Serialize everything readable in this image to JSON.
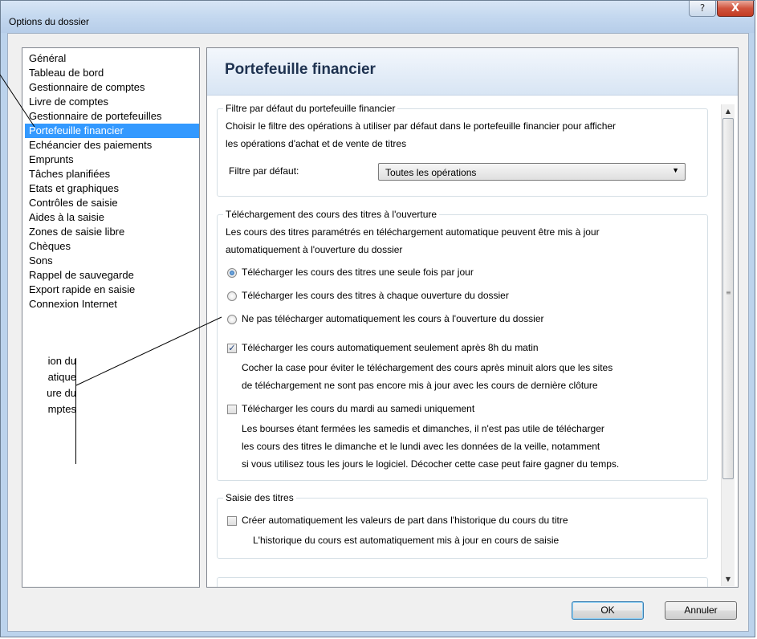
{
  "window": {
    "title": "Options du dossier",
    "help_label": "?",
    "close_label": "X"
  },
  "sidebar": {
    "items": [
      {
        "label": "Général"
      },
      {
        "label": "Tableau de bord"
      },
      {
        "label": "Gestionnaire de comptes"
      },
      {
        "label": "Livre de comptes"
      },
      {
        "label": "Gestionnaire de portefeuilles"
      },
      {
        "label": "Portefeuille financier",
        "selected": true
      },
      {
        "label": "Echéancier des paiements"
      },
      {
        "label": "Emprunts"
      },
      {
        "label": "Tâches planifiées"
      },
      {
        "label": "Etats et graphiques"
      },
      {
        "label": "Contrôles de saisie"
      },
      {
        "label": "Aides à la saisie"
      },
      {
        "label": "Zones de saisie libre"
      },
      {
        "label": "Chèques"
      },
      {
        "label": "Sons"
      },
      {
        "label": "Rappel de sauvegarde"
      },
      {
        "label": "Export rapide en saisie"
      },
      {
        "label": "Connexion Internet"
      }
    ]
  },
  "main": {
    "title": "Portefeuille financier",
    "filter_group": {
      "legend": "Filtre par défaut du portefeuille financier",
      "desc_line1": "Choisir le filtre des opérations à utiliser par défaut dans le portefeuille financier pour afficher",
      "desc_line2": "les opérations d'achat et de vente de titres",
      "filter_label": "Filtre par défaut:",
      "filter_value": "Toutes les opérations"
    },
    "download_group": {
      "legend": "Téléchargement des cours des titres à l'ouverture",
      "desc_line1": "Les cours des titres paramétrés en téléchargement automatique peuvent être mis à jour",
      "desc_line2": "automatiquement à l'ouverture du dossier",
      "radio_once": "Télécharger les cours des titres une seule fois par jour",
      "radio_each": "Télécharger les cours des titres à chaque ouverture du dossier",
      "radio_none": "Ne pas télécharger automatiquement les cours à l'ouverture du dossier",
      "check_after8": "Télécharger les cours automatiquement seulement après 8h du matin",
      "after8_desc1": "Cocher la case pour éviter le téléchargement des cours après minuit alors que les sites",
      "after8_desc2": "de téléchargement ne sont pas encore mis à jour avec les cours de dernière clôture",
      "check_tuesat": "Télécharger les cours du mardi au samedi uniquement",
      "tuesat_desc1": "Les bourses étant fermées les samedis et dimanches, il n'est pas utile de télécharger",
      "tuesat_desc2": "les cours des titres le dimanche et le lundi avec les données de la veille, notamment",
      "tuesat_desc3": "si vous utilisez tous les jours le logiciel. Décocher cette case peut faire gagner du temps."
    },
    "securities_group": {
      "legend": "Saisie des titres",
      "check_create": "Créer automatiquement les valeurs de part dans l'historique du cours du titre",
      "create_desc": "L'historique du cours est automatiquement mis à jour en cours de saisie"
    }
  },
  "buttons": {
    "ok": "OK",
    "cancel": "Annuler"
  },
  "callout": {
    "line1": "ion du",
    "line2": "atique",
    "line3": "ure du",
    "line4": "mptes"
  },
  "colors": {
    "selection": "#3399ff",
    "title_bar": "#c4d8ef",
    "close_button": "#c23b22"
  }
}
